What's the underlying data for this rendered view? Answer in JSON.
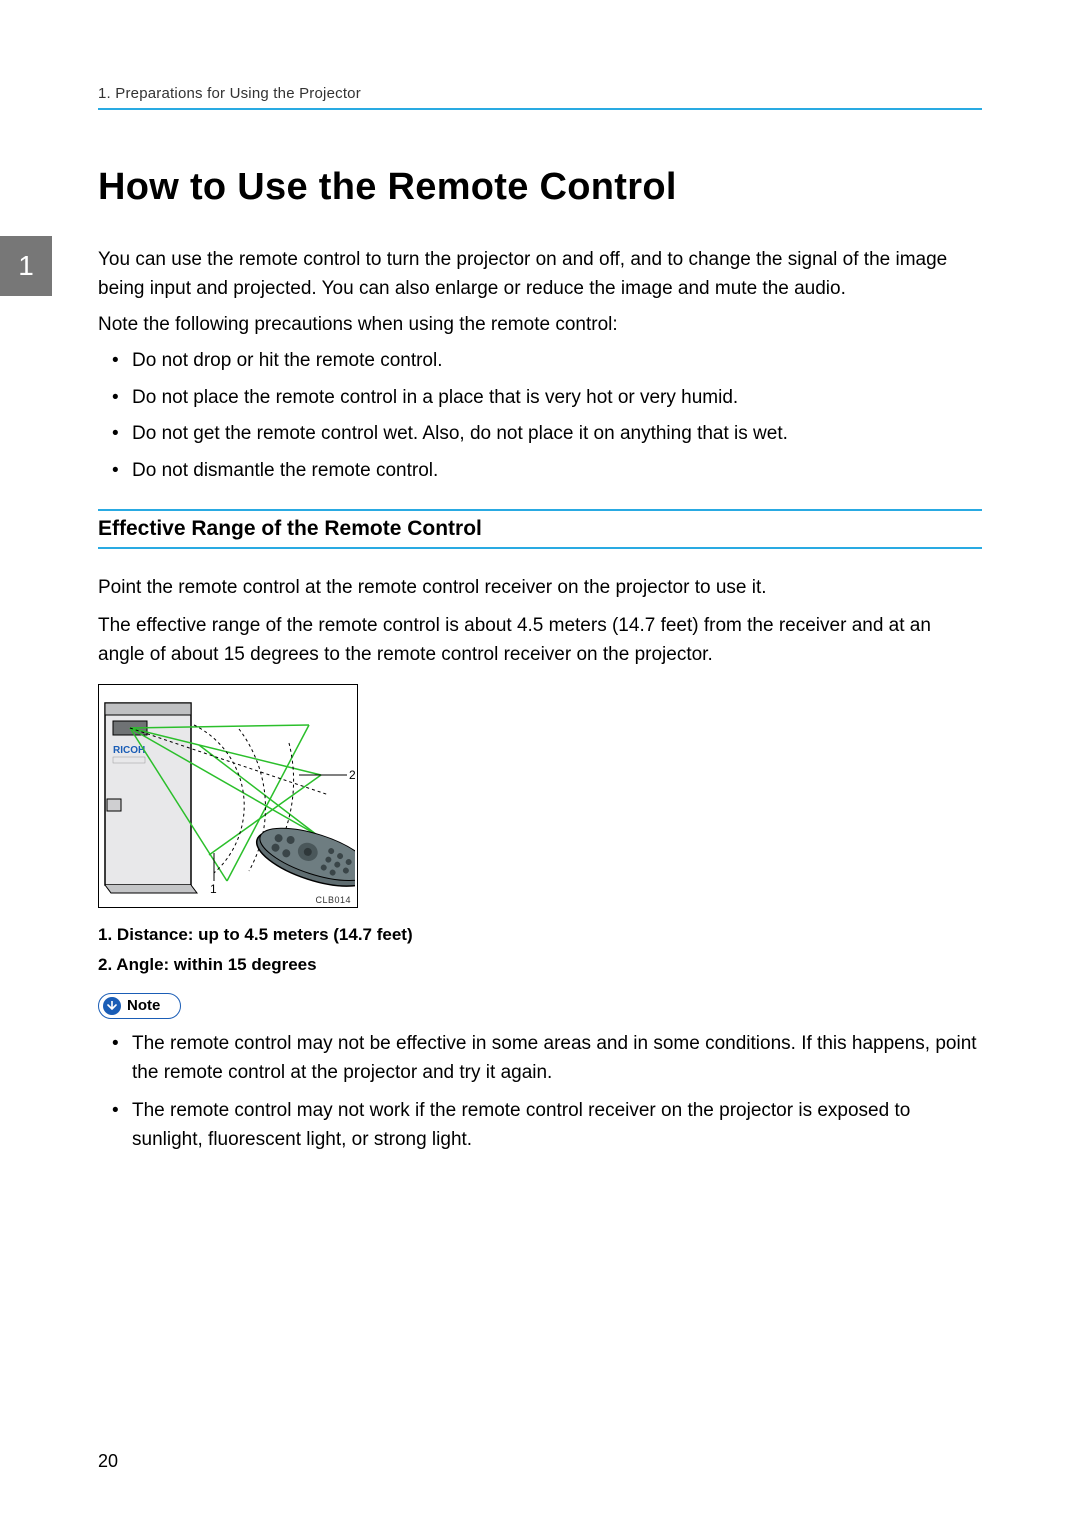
{
  "header": {
    "breadcrumb": "1. Preparations for Using the Projector",
    "chapter_tab": "1"
  },
  "title": "How to Use the Remote Control",
  "intro": [
    "You can use the remote control to turn the projector on and off, and to change the signal of the image being input and projected. You can also enlarge or reduce the image and mute the audio.",
    "Note the following precautions when using the remote control:"
  ],
  "precautions": [
    "Do not drop or hit the remote control.",
    "Do not place the remote control in a place that is very hot or very humid.",
    "Do not get the remote control wet. Also, do not place it on anything that is wet.",
    "Do not dismantle the remote control."
  ],
  "section": {
    "heading": "Effective Range of the Remote Control",
    "p1": "Point the remote control at the remote control receiver on the projector to use it.",
    "p2": "The effective range of the remote control is about 4.5 meters (14.7 feet) from the receiver and at an angle of about 15 degrees to the remote control receiver on the projector."
  },
  "diagram": {
    "brand": "RICOH",
    "label1": "1",
    "label2": "2",
    "code": "CLB014"
  },
  "range_list": [
    "Distance: up to 4.5 meters (14.7 feet)",
    "Angle: within 15 degrees"
  ],
  "note": {
    "label": "Note",
    "items": [
      "The remote control may not be effective in some areas and in some conditions. If this happens, point the remote control at the projector and try it again.",
      "The remote control may not work if the remote control receiver on the projector is exposed to sunlight, fluorescent light, or strong light."
    ]
  },
  "page_number": "20"
}
